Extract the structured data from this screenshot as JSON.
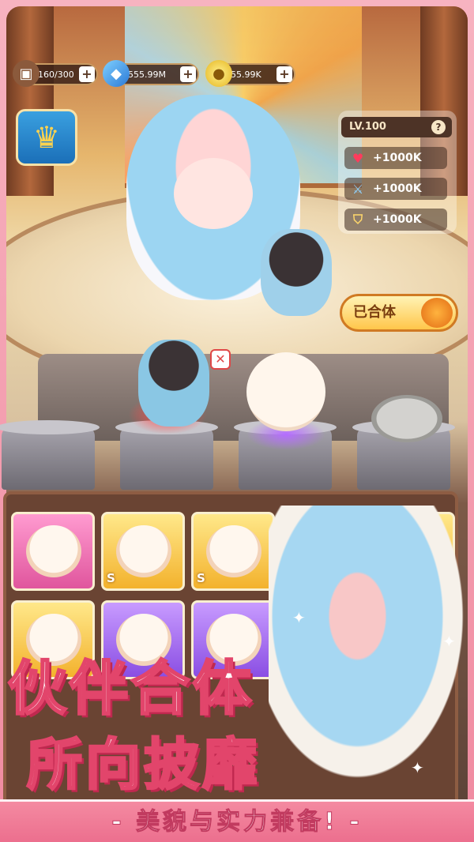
{
  "resources": {
    "capacity": "160/300",
    "gems": "555.99M",
    "coins": "55.99K",
    "plus": "+"
  },
  "stats": {
    "level": "LV.100",
    "help": "?",
    "hp": "+1000K",
    "attack": "+1000K",
    "defense": "+1000K"
  },
  "actions": {
    "merged_label": "已合体",
    "close": "✕"
  },
  "inventory": {
    "rank_badge": "S"
  },
  "poster": {
    "line1": "伙伴合体",
    "line2": "所向披靡",
    "tagline": "- 美貌与实力兼备! -"
  },
  "icons": {
    "capacity": "bag-icon",
    "gems": "diamond-icon",
    "coins": "coin-icon",
    "trophy": "trophy-icon",
    "hp": "heart-icon",
    "attack": "sword-icon",
    "defense": "shield-icon"
  },
  "colors": {
    "accent_pink": "#e2456b",
    "panel_brown": "#4d3326",
    "gold": "#ffc64a"
  }
}
